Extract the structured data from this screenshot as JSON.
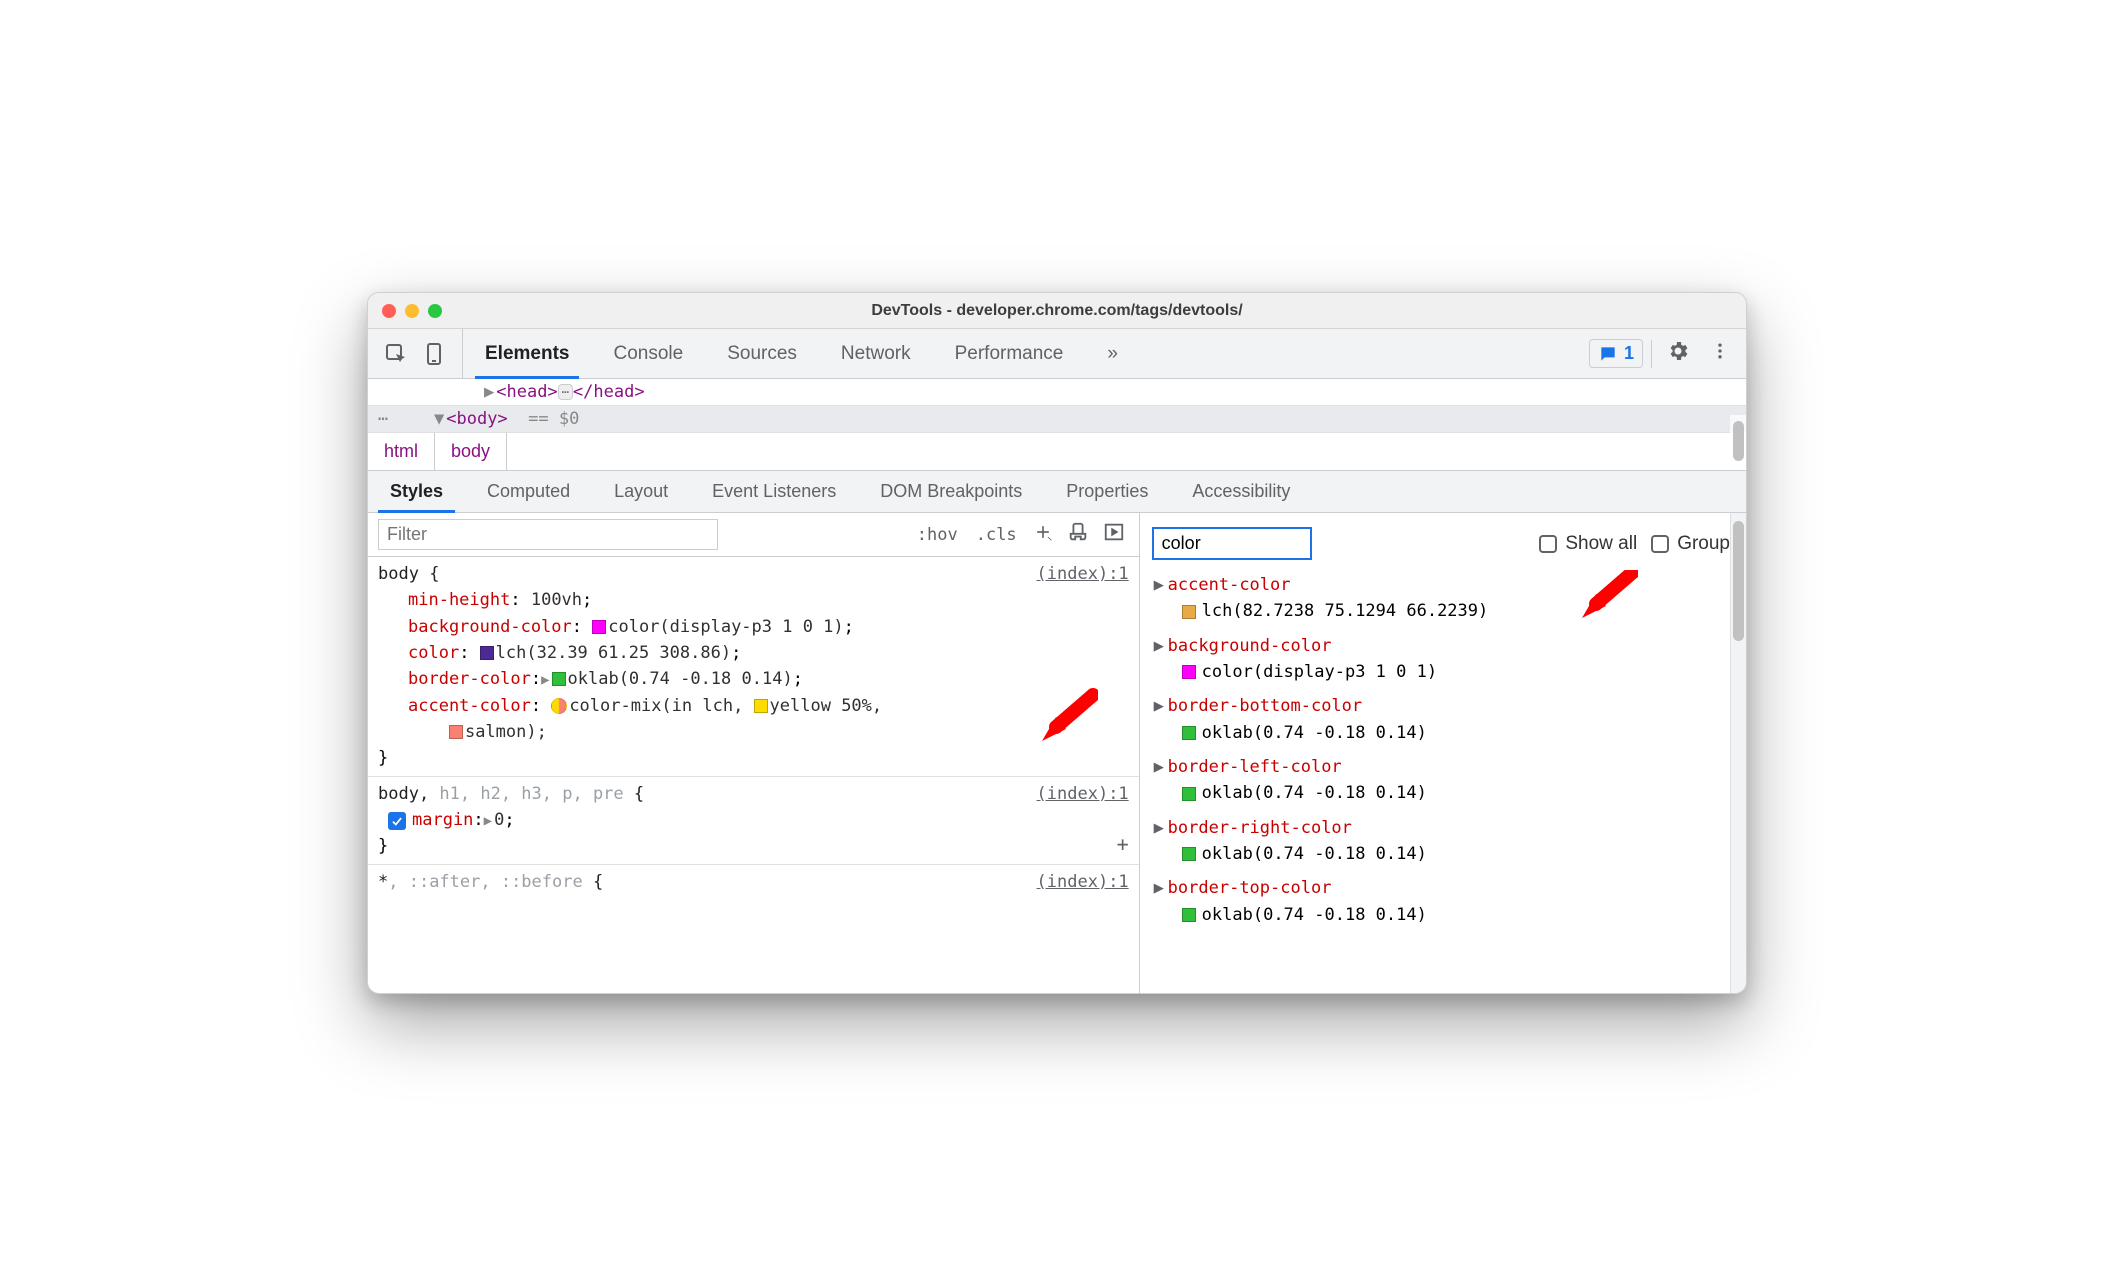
{
  "window_title": "DevTools - developer.chrome.com/tags/devtools/",
  "main_tabs": [
    "Elements",
    "Console",
    "Sources",
    "Network",
    "Performance"
  ],
  "main_tab_active": "Elements",
  "issues_badge": "1",
  "dom": {
    "line1_open": "<head>",
    "line1_close": "</head>",
    "line2": "<body>",
    "line2_suffix": "== $0"
  },
  "breadcrumb": [
    "html",
    "body"
  ],
  "sub_tabs": [
    "Styles",
    "Computed",
    "Layout",
    "Event Listeners",
    "DOM Breakpoints",
    "Properties",
    "Accessibility"
  ],
  "sub_tab_active": "Styles",
  "styles_filter_placeholder": "Filter",
  "styles_buttons": {
    "hov": ":hov",
    "cls": ".cls"
  },
  "rules": [
    {
      "selector_main": "body",
      "selector_dim": "",
      "brace": "{",
      "close": "}",
      "source": "(index):1",
      "props": [
        {
          "name": "min-height",
          "value": "100vh",
          "swatch": null,
          "expand": false,
          "mix": false
        },
        {
          "name": "background-color",
          "value": "color(display-p3 1 0 1)",
          "swatch": "#ff00ff",
          "expand": false,
          "mix": false
        },
        {
          "name": "color",
          "value": "lch(32.39 61.25 308.86)",
          "swatch": "#4b2a94",
          "expand": false,
          "mix": false
        },
        {
          "name": "border-color",
          "value": "oklab(0.74 -0.18 0.14)",
          "swatch": "#2fbf3a",
          "expand": true,
          "mix": false
        },
        {
          "name": "accent-color",
          "value_pre": "color-mix(in lch, ",
          "yellow_swatch": "#ffdc00",
          "yellow_text": "yellow 50%,",
          "salmon_swatch": "#fa8072",
          "salmon_text": "salmon);",
          "mix": true
        }
      ]
    },
    {
      "selector_main": "body,",
      "selector_dim": " h1, h2, h3, p, pre",
      "brace": "{",
      "close": "}",
      "source": "(index):1",
      "props": [
        {
          "name": "margin",
          "value": "0",
          "checked": true,
          "expand": true
        }
      ]
    },
    {
      "selector_main": "*",
      "selector_dim": ", ::after, ::before",
      "brace": "{",
      "source": "(index):1",
      "props": []
    }
  ],
  "computed_filter_value": "color",
  "show_all_label": "Show all",
  "group_label": "Group",
  "computed": [
    {
      "name": "accent-color",
      "swatch": "#e8a947",
      "value": "lch(82.7238 75.1294 66.2239)"
    },
    {
      "name": "background-color",
      "swatch": "#ff00ff",
      "value": "color(display-p3 1 0 1)"
    },
    {
      "name": "border-bottom-color",
      "swatch": "#2fbf3a",
      "value": "oklab(0.74 -0.18 0.14)"
    },
    {
      "name": "border-left-color",
      "swatch": "#2fbf3a",
      "value": "oklab(0.74 -0.18 0.14)"
    },
    {
      "name": "border-right-color",
      "swatch": "#2fbf3a",
      "value": "oklab(0.74 -0.18 0.14)"
    },
    {
      "name": "border-top-color",
      "swatch": "#2fbf3a",
      "value": "oklab(0.74 -0.18 0.14)",
      "cut": true
    }
  ]
}
